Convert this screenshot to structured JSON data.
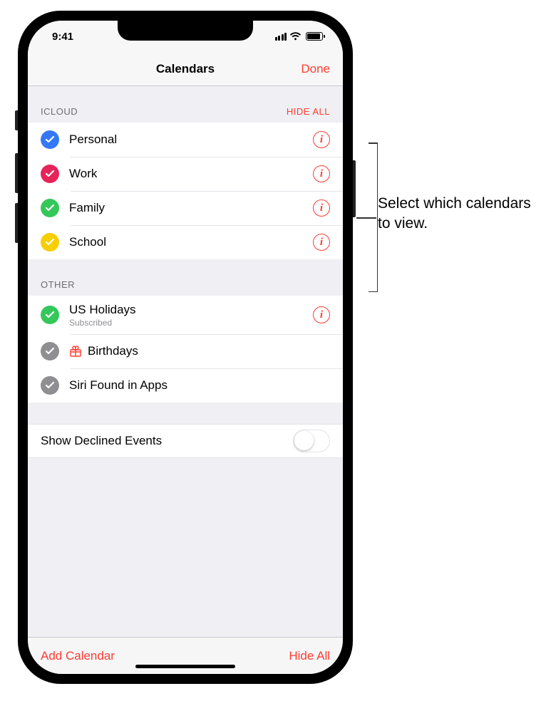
{
  "status": {
    "time": "9:41"
  },
  "nav": {
    "title": "Calendars",
    "done": "Done"
  },
  "sections": [
    {
      "label": "ICLOUD",
      "action": "HIDE ALL",
      "items": [
        {
          "title": "Personal",
          "color": "#3478f6",
          "info": true
        },
        {
          "title": "Work",
          "color": "#e6245a",
          "info": true
        },
        {
          "title": "Family",
          "color": "#34c759",
          "info": true
        },
        {
          "title": "School",
          "color": "#f7ce00",
          "info": true
        }
      ]
    },
    {
      "label": "OTHER",
      "action": "",
      "items": [
        {
          "title": "US Holidays",
          "sub": "Subscribed",
          "color": "#34c759",
          "info": true
        },
        {
          "title": "Birthdays",
          "color": "#8e8e93",
          "gift": true,
          "giftColor": "#ff3b30"
        },
        {
          "title": "Siri Found in Apps",
          "color": "#8e8e93"
        }
      ]
    }
  ],
  "toggle": {
    "label": "Show Declined Events",
    "on": false
  },
  "toolbar": {
    "left": "Add Calendar",
    "right": "Hide All"
  },
  "callout": {
    "text": "Select which calendars to view."
  }
}
